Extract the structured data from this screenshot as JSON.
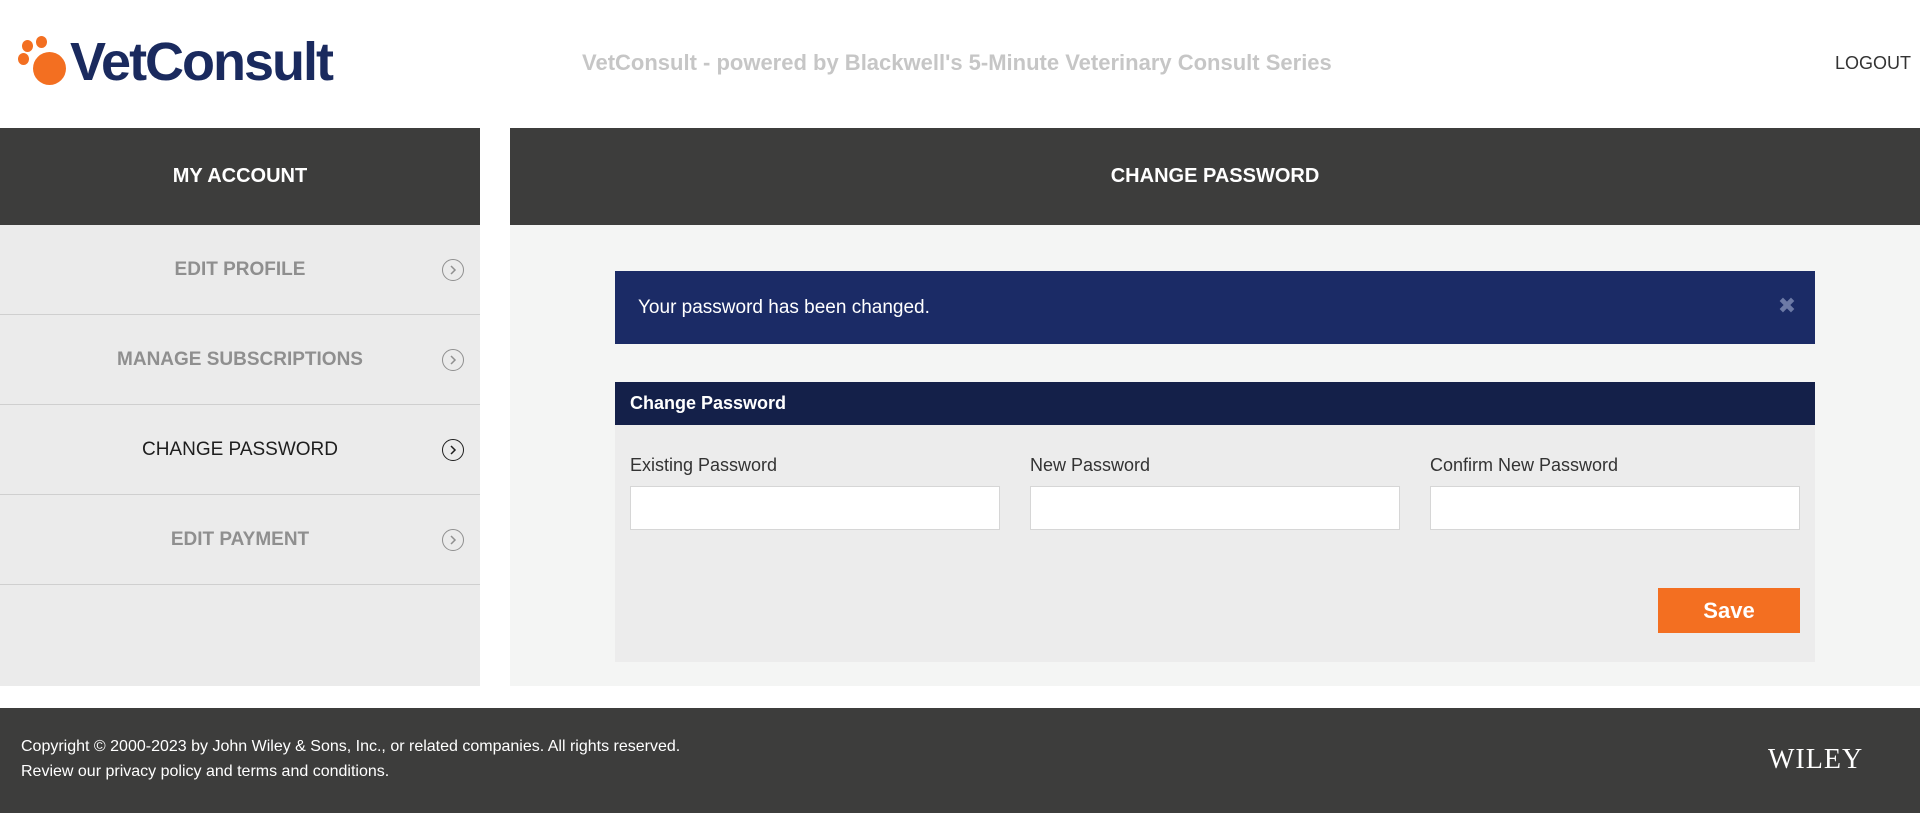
{
  "header": {
    "logo_text": "VetConsult",
    "tagline": "VetConsult - powered by Blackwell's 5-Minute Veterinary Consult Series",
    "logout_label": "LOGOUT"
  },
  "sidebar": {
    "title": "MY ACCOUNT",
    "items": [
      {
        "label": "EDIT PROFILE",
        "active": false
      },
      {
        "label": "MANAGE SUBSCRIPTIONS",
        "active": false
      },
      {
        "label": "CHANGE PASSWORD",
        "active": true
      },
      {
        "label": "EDIT PAYMENT",
        "active": false
      }
    ]
  },
  "main": {
    "title": "CHANGE PASSWORD",
    "alert_message": "Your password has been changed.",
    "panel_title": "Change Password",
    "fields": {
      "existing": {
        "label": "Existing Password",
        "value": ""
      },
      "new": {
        "label": "New Password",
        "value": ""
      },
      "confirm": {
        "label": "Confirm New Password",
        "value": ""
      }
    },
    "save_label": "Save"
  },
  "footer": {
    "copyright": "Copyright © 2000-2023 by John Wiley & Sons, Inc., or related companies. All rights reserved.",
    "review_prefix": "Review our ",
    "privacy_link": "privacy policy",
    "and_text": " and ",
    "terms_link": "terms and conditions",
    "period": ".",
    "brand": "WILEY"
  },
  "colors": {
    "accent": "#f36f21",
    "navy": "#1b2b66",
    "dark_bar": "#3d3d3c"
  }
}
